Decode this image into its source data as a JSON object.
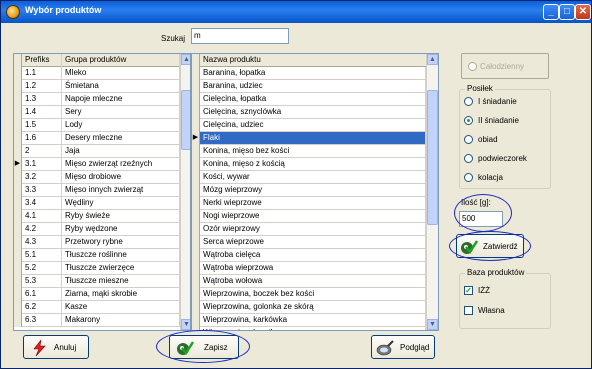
{
  "window": {
    "title": "Wybór produktów"
  },
  "search": {
    "label": "Szukaj",
    "value": "m"
  },
  "groups_table": {
    "headers": [
      "Prefiks",
      "Grupa produktów"
    ],
    "selected_index": 8,
    "rows": [
      [
        "1.1",
        "Mleko"
      ],
      [
        "1.2",
        "Śmietana"
      ],
      [
        "1.3",
        "Napoje mleczne"
      ],
      [
        "1.4",
        "Sery"
      ],
      [
        "1.5",
        "Lody"
      ],
      [
        "1.6",
        "Desery mleczne"
      ],
      [
        "2",
        "Jaja"
      ],
      [
        "3.1",
        "Mięso zwierząt rzeźnych"
      ],
      [
        "3.2",
        "Mięso drobiowe"
      ],
      [
        "3.3",
        "Mięso innych zwierząt"
      ],
      [
        "3.4",
        "Wędliny"
      ],
      [
        "4.1",
        "Ryby świeże"
      ],
      [
        "4.2",
        "Ryby wędzone"
      ],
      [
        "4.3",
        "Przetwory rybne"
      ],
      [
        "5.1",
        "Tłuszcze roślinne"
      ],
      [
        "5.2",
        "Tłuszcze zwierzęce"
      ],
      [
        "5.3",
        "Tłuszcze mieszne"
      ],
      [
        "6.1",
        "Ziarna, mąki skrobie"
      ],
      [
        "6.2",
        "Kasze"
      ],
      [
        "6.3",
        "Makarony"
      ]
    ]
  },
  "products_table": {
    "header": "Nazwa produktu",
    "selected_index": 4,
    "rows": [
      "Baranina, łopatka",
      "Baranina, udziec",
      "Cielęcina, łopatka",
      "Cielęcina, sznyclówka",
      "Cielęcina, udziec",
      "Flaki",
      "Konina, mięso bez kości",
      "Konina, mięso z kością",
      "Kości, wywar",
      "Mózg wieprzowy",
      "Nerki wieprzowe",
      "Nogi wieprzowe",
      "Ozór wieprzowy",
      "Serca wieprzowe",
      "Wątroba cielęca",
      "Wątroba wieprzowa",
      "Wątroba wołowa",
      "Wieprzowina, boczek bez kości",
      "Wieprzowina, golonka ze skórą",
      "Wieprzowina, karkówka",
      "Wieprzowina, łopatka"
    ]
  },
  "right_panel": {
    "day_checkbox_label": "Całodzienny",
    "meal_group_title": "Posiłek",
    "meals": [
      "I śniadanie",
      "II śniadanie",
      "obiad",
      "podwieczorek",
      "kolacja"
    ],
    "meal_selected": "II śniadanie",
    "amount_label": "Ilość [g]:",
    "amount_value": "500",
    "confirm_label": "Zatwierdź",
    "base_group_title": "Baza produktów",
    "base_options": [
      {
        "label": "IŻŻ",
        "checked": true
      },
      {
        "label": "Własna",
        "checked": false
      }
    ]
  },
  "buttons": {
    "cancel": "Anuluj",
    "save": "Zapisz",
    "preview": "Podgląd"
  },
  "colors": {
    "title_bar": "#0a5fd9",
    "selection": "#316ac5",
    "annotation": "#1e28c8"
  }
}
